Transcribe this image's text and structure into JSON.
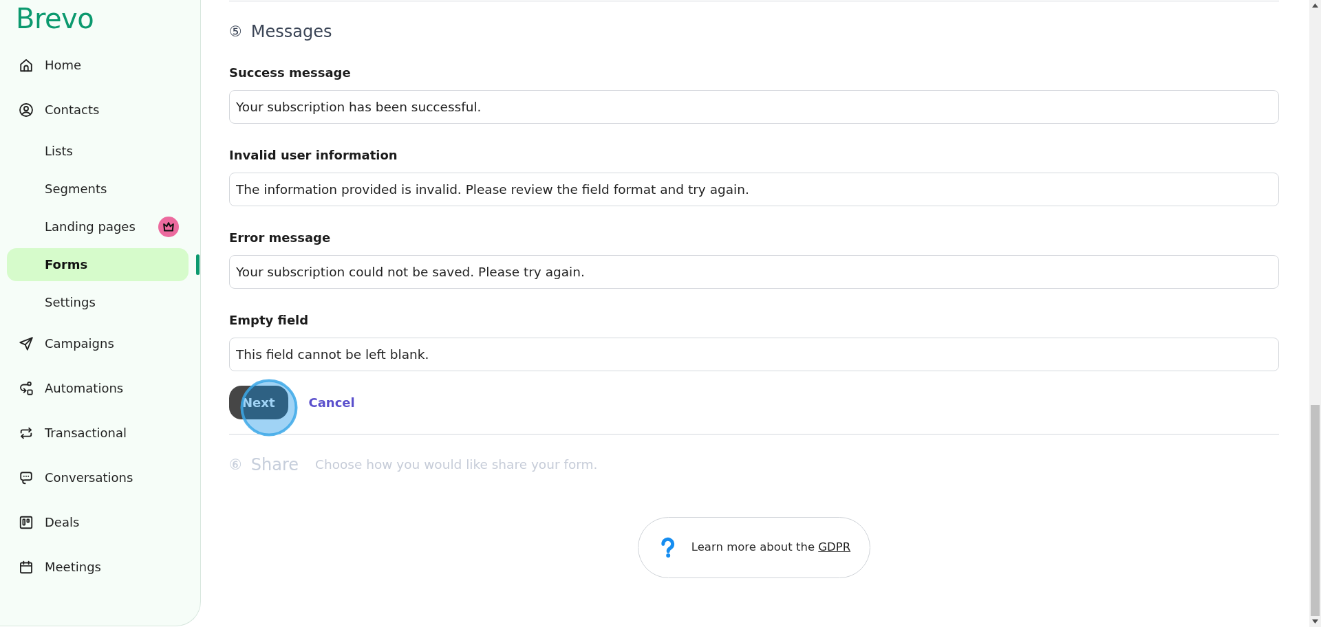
{
  "sidebar": {
    "logo": "Brevo",
    "items": [
      {
        "label": "Home",
        "selected": false
      },
      {
        "label": "Contacts",
        "selected": false,
        "children": [
          {
            "label": "Lists",
            "selected": false,
            "premium": false
          },
          {
            "label": "Segments",
            "selected": false,
            "premium": false
          },
          {
            "label": "Landing pages",
            "selected": false,
            "premium": true
          },
          {
            "label": "Forms",
            "selected": true,
            "premium": false
          },
          {
            "label": "Settings",
            "selected": false,
            "premium": false
          }
        ]
      },
      {
        "label": "Campaigns",
        "selected": false
      },
      {
        "label": "Automations",
        "selected": false
      },
      {
        "label": "Transactional",
        "selected": false
      },
      {
        "label": "Conversations",
        "selected": false
      },
      {
        "label": "Deals",
        "selected": false
      },
      {
        "label": "Meetings",
        "selected": false
      }
    ]
  },
  "messages_step": {
    "number": "⑤",
    "title": "Messages",
    "disabled": false,
    "fields": [
      {
        "label": "Success message",
        "value": "Your subscription has been successful."
      },
      {
        "label": "Invalid user information",
        "value": "The information provided is invalid. Please review the field format and try again."
      },
      {
        "label": "Error message",
        "value": "Your subscription could not be saved. Please try again."
      },
      {
        "label": "Empty field",
        "value": "This field cannot be left blank."
      }
    ],
    "buttons": [
      {
        "kind": "primary",
        "label": "Next"
      },
      {
        "kind": "link",
        "label": "Cancel"
      }
    ]
  },
  "share_step": {
    "number": "⑥",
    "title": "Share",
    "description": "Choose how you would like share your form.",
    "disabled": true
  },
  "help": {
    "text": "Learn more about the",
    "link": "GDPR"
  }
}
